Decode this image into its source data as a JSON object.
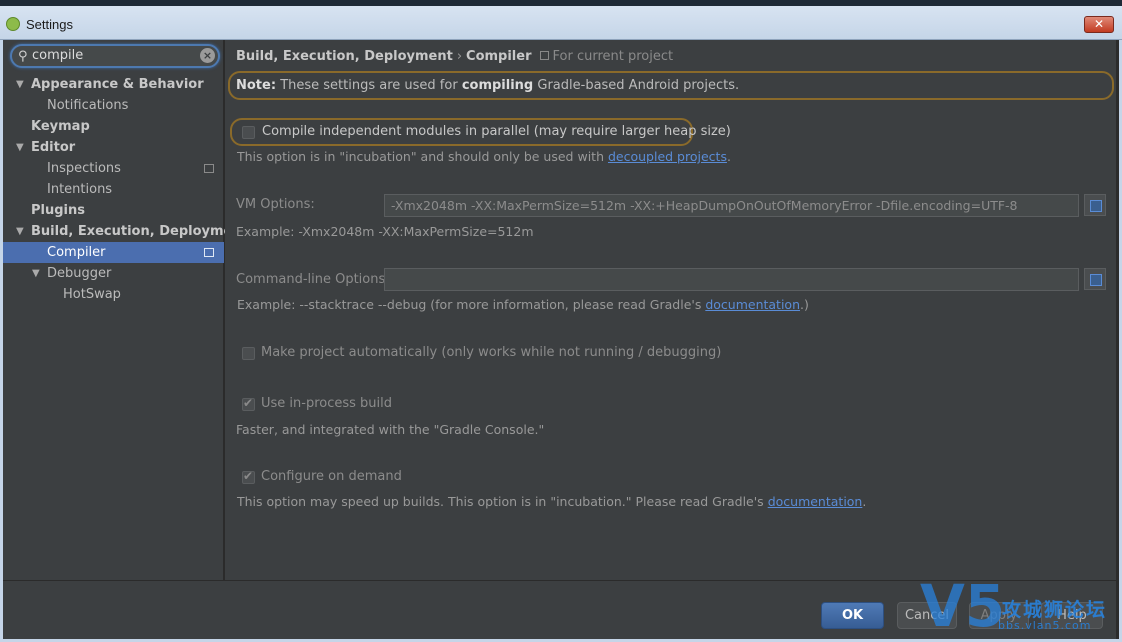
{
  "window": {
    "title": "Settings",
    "close_glyph": "✕"
  },
  "search": {
    "value": "compile",
    "icon": "search-icon",
    "clear_glyph": "×"
  },
  "tree": {
    "appearance": "Appearance & Behavior",
    "notifications": "Notifications",
    "keymap": "Keymap",
    "editor": "Editor",
    "inspections": "Inspections",
    "intentions": "Intentions",
    "plugins": "Plugins",
    "build": "Build, Execution, Deployment",
    "compiler": "Compiler",
    "debugger": "Debugger",
    "hotswap": "HotSwap"
  },
  "breadcrumb": {
    "section": "Build, Execution, Deployment",
    "separator": "›",
    "page": "Compiler",
    "scope": "For current project"
  },
  "note": {
    "prefix": "Note:",
    "text_before": "These settings are used for",
    "keyword": "compiling",
    "text_after": "Gradle-based Android projects."
  },
  "parallel": {
    "label": "Compile independent modules in parallel (may require larger heap size)",
    "checked": false,
    "hint_before": "This option is in \"incubation\" and should only be used with",
    "hint_link": "decoupled projects",
    "hint_after": "."
  },
  "vm_options": {
    "label": "VM Options:",
    "value": "-Xmx2048m -XX:MaxPermSize=512m -XX:+HeapDumpOnOutOfMemoryError -Dfile.encoding=UTF-8",
    "example": "Example: -Xmx2048m -XX:MaxPermSize=512m"
  },
  "cmdline": {
    "label": "Command-line Options:",
    "value": "",
    "hint_before": "Example: --stacktrace --debug (for more information, please read Gradle's",
    "hint_link": "documentation",
    "hint_after": ".)"
  },
  "make_auto": {
    "label": "Make project automatically (only works while not running / debugging)",
    "checked": false
  },
  "in_process": {
    "label": "Use in-process build",
    "checked": true,
    "hint": "Faster, and integrated with the \"Gradle Console.\""
  },
  "on_demand": {
    "label": "Configure on demand",
    "checked": true,
    "hint_before": "This option may speed up builds. This option is in \"incubation.\" Please read Gradle's",
    "hint_link": "documentation",
    "hint_after": "."
  },
  "buttons": {
    "ok": "OK",
    "cancel": "Cancel",
    "apply": "Apply",
    "help": "Help"
  },
  "watermark": {
    "logo": "V5",
    "name": "攻城狮论坛",
    "url": "bbs.vlan5.com"
  },
  "colors": {
    "accent": "#4b6eaf",
    "highlight_border": "#8a6a2a",
    "link": "#5a8cd6",
    "background": "#3c3f41"
  }
}
